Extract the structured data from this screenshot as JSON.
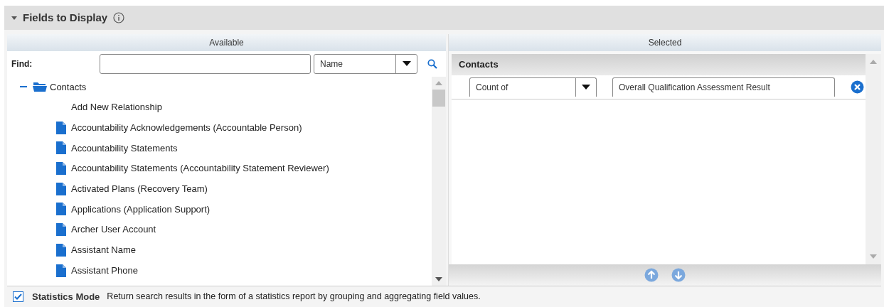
{
  "section": {
    "title": "Fields to Display",
    "expanded": true
  },
  "available": {
    "header": "Available",
    "find_label": "Find:",
    "find_by": "Name",
    "tree": [
      {
        "label": "Contacts",
        "kind": "folder",
        "expanded": true,
        "children": [
          {
            "label": "Add New Relationship",
            "kind": "action"
          },
          {
            "label": "Accountability Acknowledgements (Accountable Person)",
            "kind": "field"
          },
          {
            "label": "Accountability Statements",
            "kind": "field"
          },
          {
            "label": "Accountability Statements (Accountability Statement Reviewer)",
            "kind": "field"
          },
          {
            "label": "Activated Plans (Recovery Team)",
            "kind": "field"
          },
          {
            "label": "Applications (Application Support)",
            "kind": "field"
          },
          {
            "label": "Archer User Account",
            "kind": "field"
          },
          {
            "label": "Assistant Name",
            "kind": "field"
          },
          {
            "label": "Assistant Phone",
            "kind": "field"
          }
        ]
      }
    ]
  },
  "selected": {
    "header": "Selected",
    "groups": [
      {
        "title": "Contacts",
        "rows": [
          {
            "aggregate": "Count of",
            "field": "Overall Qualification Assessment Result"
          }
        ]
      }
    ]
  },
  "statistics_mode": {
    "checked": true,
    "label": "Statistics Mode",
    "description": "Return search results in the form of a statistics report by grouping and aggregating field values."
  }
}
